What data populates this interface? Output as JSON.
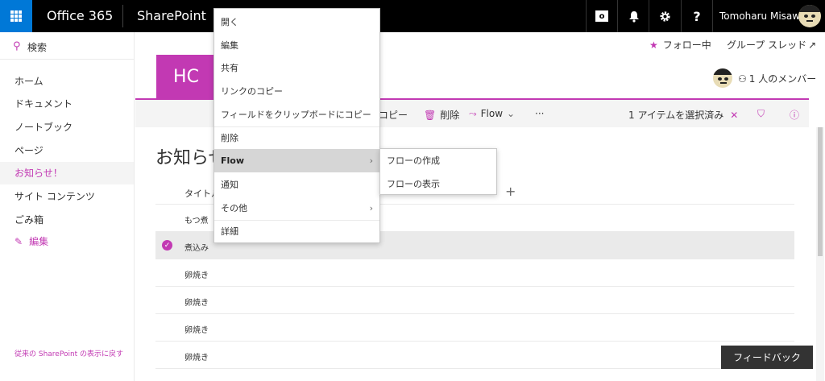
{
  "suitebar": {
    "brand": "Office 365",
    "app": "SharePoint",
    "username": "Tomoharu Misawa",
    "help": "?",
    "outlook_letter": "o",
    "colors": {
      "bar": "#000000",
      "waffle": "#0078d7"
    }
  },
  "search": {
    "label": "検索"
  },
  "nav": {
    "items": [
      {
        "label": "ホーム"
      },
      {
        "label": "ドキュメント"
      },
      {
        "label": "ノートブック"
      },
      {
        "label": "ページ"
      },
      {
        "label": "お知らせ！"
      },
      {
        "label": "サイト コンテンツ"
      },
      {
        "label": "ごみ箱"
      }
    ],
    "edit": "編集",
    "old_link": "従来の SharePoint の表示に戻す"
  },
  "header": {
    "tile": "HC",
    "follow": "フォロー中",
    "thread": "グループ スレッド",
    "thread_arrow": "↗",
    "members": "1 人のメンバー"
  },
  "commandbar": {
    "copy": "コピー",
    "delete": "削除",
    "flow": "Flow",
    "more": "···",
    "selected": "1 アイテムを選択済み"
  },
  "page": {
    "title": "お知らせ",
    "column_title": "タイトル",
    "rows": [
      "もつ煮",
      "煮込み",
      "卵焼き",
      "卵焼き",
      "卵焼き",
      "卵焼き"
    ],
    "selected_row_index": 1
  },
  "feedback": "フィードバック",
  "context_menu": {
    "items": [
      "開く",
      "編集",
      "共有",
      "リンクのコピー",
      "フィールドをクリップボードにコピー",
      "削除",
      "Flow",
      "通知",
      "その他",
      "詳細"
    ],
    "highlighted_index": 6,
    "submenu_arrow": "›"
  },
  "flow_submenu": {
    "items": [
      "フローの作成",
      "フローの表示"
    ]
  },
  "accent_color": "#c239b3"
}
